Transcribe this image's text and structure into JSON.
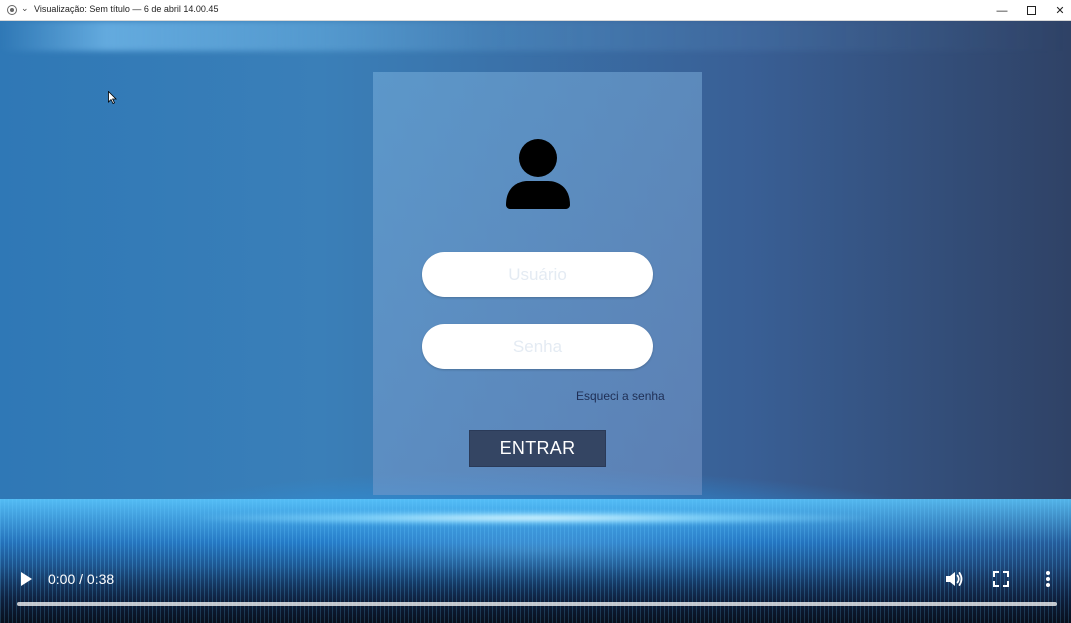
{
  "window": {
    "title": "Visualização: Sem título — 6 de abril 14.00.45",
    "minimize_icon": "minimize-icon",
    "maximize_icon": "maximize-icon",
    "close_icon": "close-icon"
  },
  "login": {
    "avatar_icon": "user-icon",
    "username_placeholder": "Usuário",
    "username_value": "",
    "password_placeholder": "Senha",
    "password_value": "",
    "forgot_label": "Esqueci a senha",
    "submit_label": "ENTRAR",
    "button_color": "#344563",
    "link_color": "#1f2f55"
  },
  "player": {
    "time_display": "0:00 / 0:38",
    "progress": 0,
    "play_icon": "play-icon",
    "volume_icon": "volume-icon",
    "fullscreen_icon": "fullscreen-icon",
    "more_icon": "more-options-icon"
  }
}
